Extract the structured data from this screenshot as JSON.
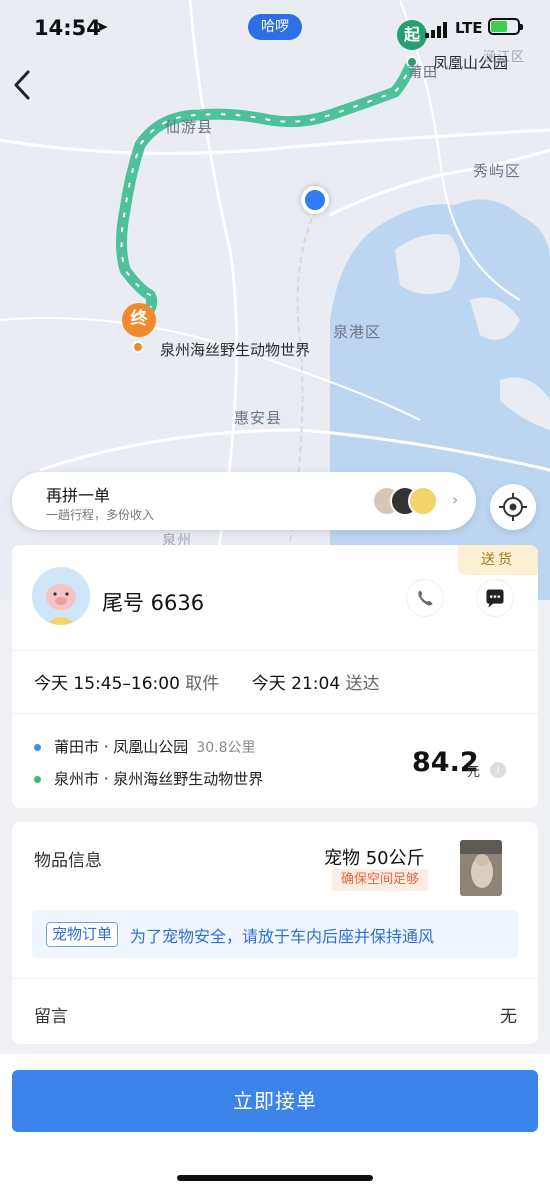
{
  "status_bar": {
    "time": "14:54",
    "center_pill": "哈啰",
    "network": "LTE"
  },
  "map": {
    "start_marker": "起",
    "end_marker": "终",
    "start_name": "凤凰山公园",
    "end_name": "泉州海丝野生动物世界",
    "labels": {
      "xianyou": "仙游县",
      "xiuyu": "秀屿区",
      "quangang": "泉港区",
      "huian": "惠安县",
      "putian": "莆田",
      "hanjiang": "涵江区",
      "quanzhou": "泉州"
    }
  },
  "repool": {
    "title": "再拼一单",
    "subtitle": "一趟行程，多份收入"
  },
  "order": {
    "tag": "送货",
    "driver": "尾号 6636",
    "pickup_time": "今天 15:45–16:00",
    "pickup_label": "取件",
    "deliver_time": "今天 21:04",
    "deliver_label": "送达",
    "from": "莆田市 · 凤凰山公园",
    "distance": "30.8公里",
    "to": "泉州市 · 泉州海丝野生动物世界",
    "price": "84.2",
    "price_unit": "元"
  },
  "item": {
    "label": "物品信息",
    "value": "宠物  50公斤",
    "space_tag": "确保空间足够",
    "notice_tag": "宠物订单",
    "notice_text": "为了宠物安全，请放于车内后座并保持通风",
    "msg_label": "留言",
    "msg_value": "无"
  },
  "actions": {
    "accept": "立即接单"
  },
  "colors": {
    "primary": "#3c83ea",
    "route": "#4cc19a",
    "start": "#25a06e",
    "end": "#f28a2b"
  }
}
